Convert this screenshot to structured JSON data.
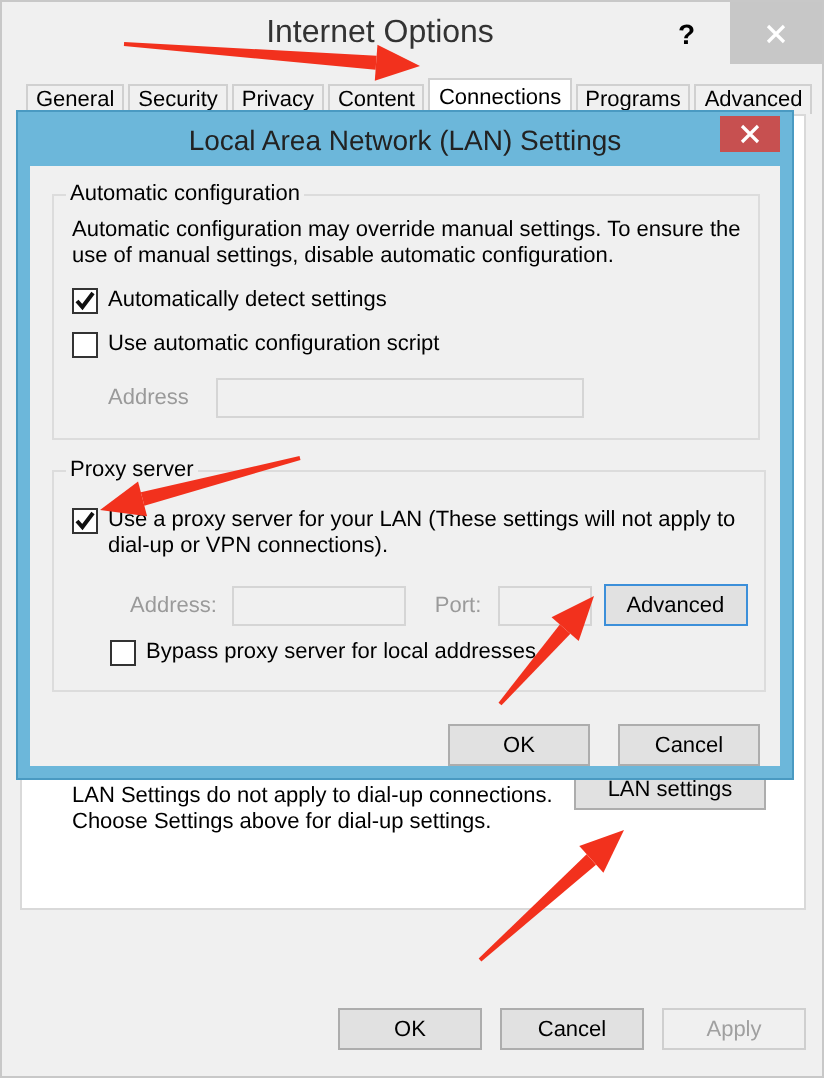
{
  "window": {
    "title": "Internet Options",
    "help": "?"
  },
  "tabs": [
    {
      "label": "General",
      "selected": false
    },
    {
      "label": "Security",
      "selected": false
    },
    {
      "label": "Privacy",
      "selected": false
    },
    {
      "label": "Content",
      "selected": false
    },
    {
      "label": "Connections",
      "selected": true
    },
    {
      "label": "Programs",
      "selected": false
    },
    {
      "label": "Advanced",
      "selected": false
    }
  ],
  "panel": {
    "lan_note": [
      "LAN Settings do not apply to dial-up connections.",
      "Choose Settings above for dial-up settings."
    ],
    "lan_button": "LAN settings"
  },
  "buttons": [
    {
      "label": "OK",
      "disabled": false
    },
    {
      "label": "Cancel",
      "disabled": false
    },
    {
      "label": "Apply",
      "disabled": true
    }
  ],
  "dialog": {
    "title": "Local Area Network (LAN) Settings",
    "automatic": {
      "title": "Automatic configuration",
      "description": "Automatic configuration may override manual settings. To ensure the use of manual settings, disable automatic configuration.",
      "detect": {
        "label": "Automatically detect settings",
        "checked": true
      },
      "script": {
        "label": "Use automatic configuration script",
        "checked": false
      },
      "address": {
        "label": "Address",
        "disabled": true
      }
    },
    "proxy": {
      "title": "Proxy server",
      "use_proxy": {
        "label": "Use a proxy server for your LAN (These settings will not apply to dial-up or VPN connections).",
        "checked": true
      },
      "address": {
        "label": "Address:",
        "disabled": true
      },
      "port": {
        "label": "Port:",
        "disabled": true
      },
      "advanced_button": "Advanced",
      "bypass": {
        "label": "Bypass proxy server for local addresses",
        "checked": false
      }
    },
    "buttons": [
      "OK",
      "Cancel"
    ]
  }
}
